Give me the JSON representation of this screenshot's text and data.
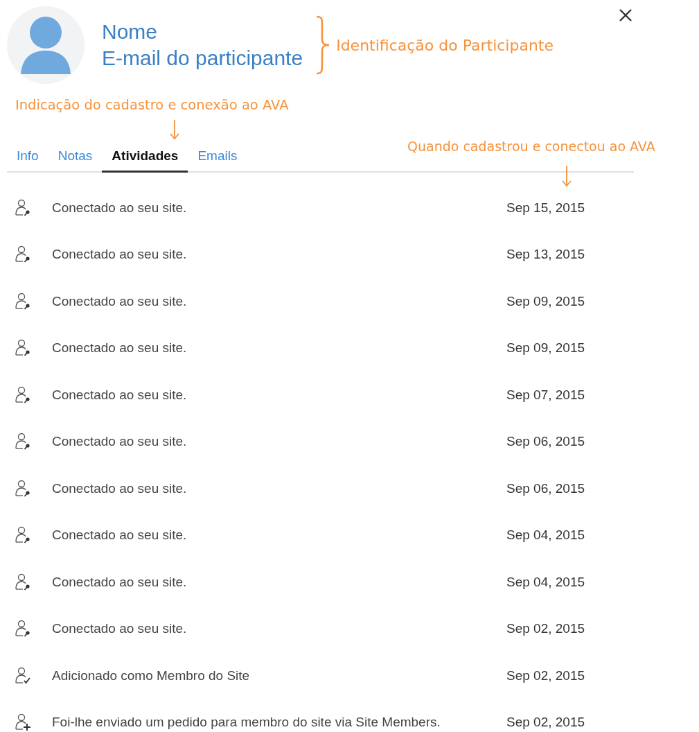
{
  "profile": {
    "name": "Nome",
    "email": "E-mail do participante"
  },
  "annotations": {
    "identity": "Identificação do Participante",
    "tabs_hint": "Indicação do cadastro e conexão ao AVA",
    "date_hint": "Quando cadastrou e conectou ao AVA"
  },
  "tabs": [
    {
      "label": "Info",
      "selected": false
    },
    {
      "label": "Notas",
      "selected": false
    },
    {
      "label": "Atividades",
      "selected": true
    },
    {
      "label": "Emails",
      "selected": false
    }
  ],
  "activities": [
    {
      "kind": "connected",
      "text": "Conectado ao seu site.",
      "date": "Sep 15, 2015"
    },
    {
      "kind": "connected",
      "text": "Conectado ao seu site.",
      "date": "Sep 13, 2015"
    },
    {
      "kind": "connected",
      "text": "Conectado ao seu site.",
      "date": "Sep 09, 2015"
    },
    {
      "kind": "connected",
      "text": "Conectado ao seu site.",
      "date": "Sep 09, 2015"
    },
    {
      "kind": "connected",
      "text": "Conectado ao seu site.",
      "date": "Sep 07, 2015"
    },
    {
      "kind": "connected",
      "text": "Conectado ao seu site.",
      "date": "Sep 06, 2015"
    },
    {
      "kind": "connected",
      "text": "Conectado ao seu site.",
      "date": "Sep 06, 2015"
    },
    {
      "kind": "connected",
      "text": "Conectado ao seu site.",
      "date": "Sep 04, 2015"
    },
    {
      "kind": "connected",
      "text": "Conectado ao seu site.",
      "date": "Sep 04, 2015"
    },
    {
      "kind": "connected",
      "text": "Conectado ao seu site.",
      "date": "Sep 02, 2015"
    },
    {
      "kind": "added",
      "text": "Adicionado como Membro do Site",
      "date": "Sep 02, 2015"
    },
    {
      "kind": "request",
      "text": "Foi-lhe enviado um pedido para membro do site via Site Members.",
      "date": "Sep 02, 2015"
    }
  ]
}
